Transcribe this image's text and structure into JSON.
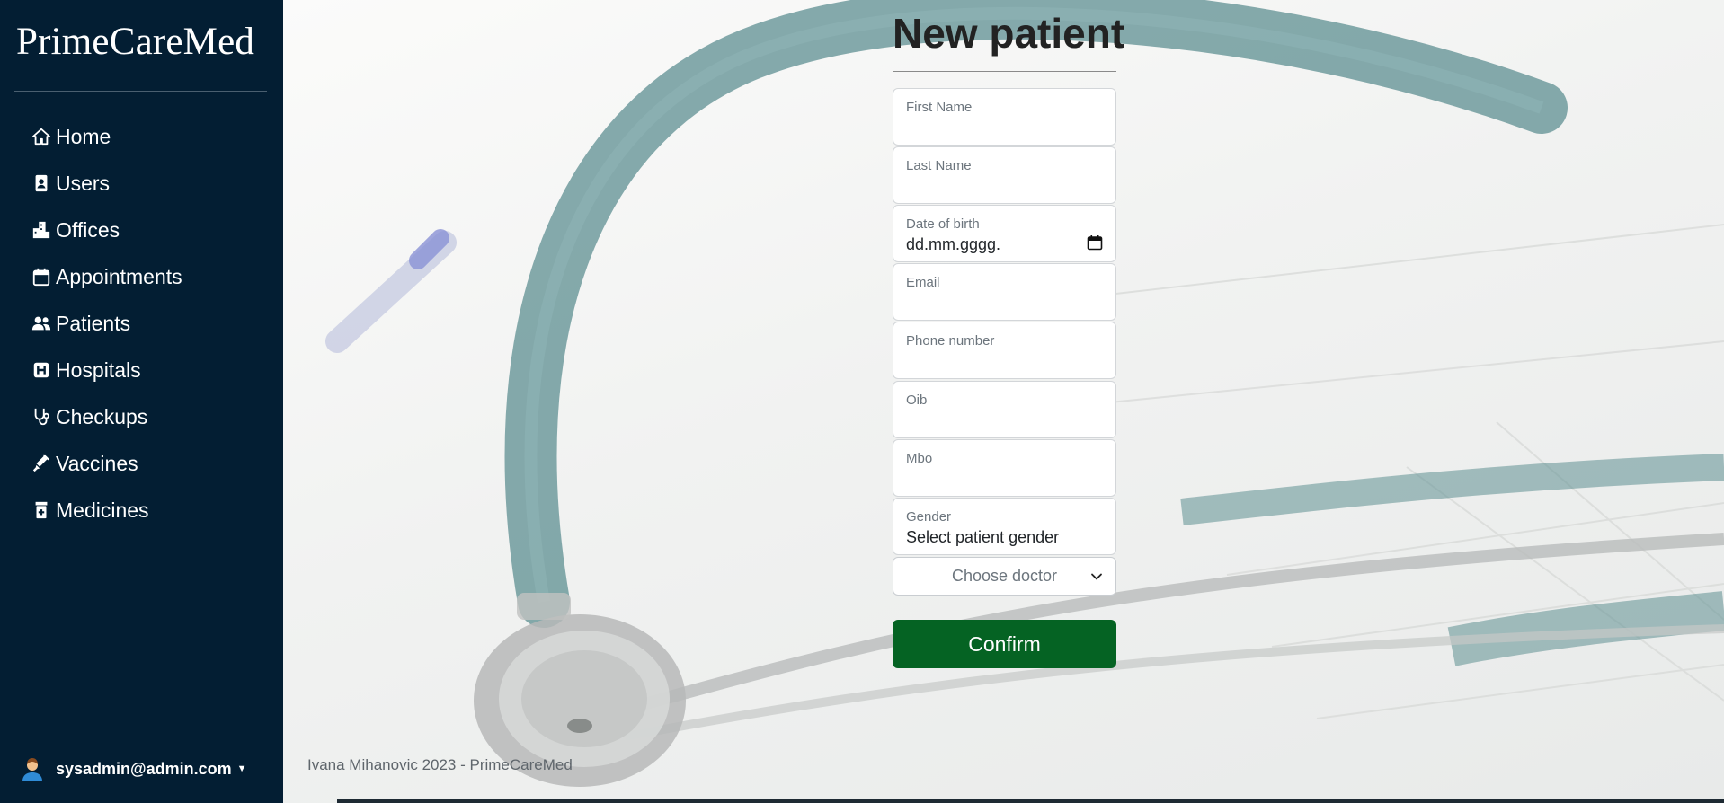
{
  "sidebar": {
    "brand": "PrimeCareMed",
    "items": [
      {
        "label": "Home",
        "icon": "home-icon"
      },
      {
        "label": "Users",
        "icon": "user-badge-icon"
      },
      {
        "label": "Offices",
        "icon": "building-icon"
      },
      {
        "label": "Appointments",
        "icon": "calendar-icon"
      },
      {
        "label": "Patients",
        "icon": "people-icon"
      },
      {
        "label": "Hospitals",
        "icon": "hospital-icon"
      },
      {
        "label": "Checkups",
        "icon": "stethoscope-icon"
      },
      {
        "label": "Vaccines",
        "icon": "syringe-icon"
      },
      {
        "label": "Medicines",
        "icon": "medicine-icon"
      }
    ],
    "user": {
      "email": "sysadmin@admin.com",
      "icon": "user-avatar-icon"
    }
  },
  "form": {
    "title": "New patient",
    "fields": {
      "first_name": {
        "label": "First Name",
        "value": ""
      },
      "last_name": {
        "label": "Last Name",
        "value": ""
      },
      "dob": {
        "label": "Date of birth",
        "value": "dd.mm.gggg."
      },
      "email": {
        "label": "Email",
        "value": ""
      },
      "phone": {
        "label": "Phone number",
        "value": ""
      },
      "oib": {
        "label": "Oib",
        "value": ""
      },
      "mbo": {
        "label": "Mbo",
        "value": ""
      },
      "gender": {
        "label": "Gender",
        "value": "Select patient gender"
      }
    },
    "doctor_select": "Choose doctor",
    "confirm_label": "Confirm"
  },
  "footer": {
    "text": "Ivana Mihanovic 2023 - PrimeCareMed"
  },
  "colors": {
    "sidebar": "#031e33",
    "confirm": "#056323",
    "accent_stethoscope": "#4f8588"
  }
}
